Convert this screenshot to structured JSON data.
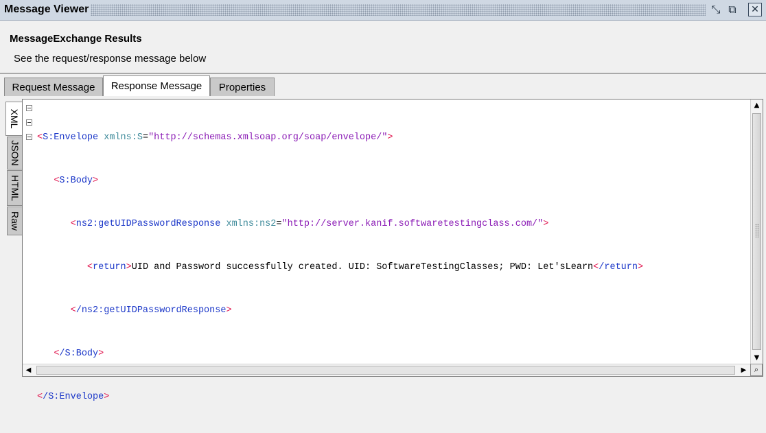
{
  "window": {
    "title": "Message Viewer",
    "icons": [
      "minimize-restore-icon",
      "maximize-icon",
      "close-icon"
    ]
  },
  "header": {
    "title": "MessageExchange Results",
    "subtitle": "See the request/response message below"
  },
  "tabs": [
    {
      "label": "Request Message",
      "active": false
    },
    {
      "label": "Response Message",
      "active": true
    },
    {
      "label": "Properties",
      "active": false
    }
  ],
  "view_tabs": [
    {
      "label": "XML",
      "active": true
    },
    {
      "label": "JSON",
      "active": false
    },
    {
      "label": "HTML",
      "active": false
    },
    {
      "label": "Raw",
      "active": false
    }
  ],
  "xml": {
    "l1_tag": "S:Envelope",
    "l1_attr": "xmlns:S",
    "l1_val": "\"http://schemas.xmlsoap.org/soap/envelope/\"",
    "l2_tag": "S:Body",
    "l3_tag": "ns2:getUIDPasswordResponse",
    "l3_attr": "xmlns:ns2",
    "l3_val": "\"http://server.kanif.softwaretestingclass.com/\"",
    "l4_tag": "return",
    "l4_text": "UID and Password successfully created. UID: SoftwareTestingClasses; PWD: Let'sLearn",
    "l4_close": "/return",
    "l5_close": "/ns2:getUIDPasswordResponse",
    "l6_close": "/S:Body",
    "l7_close": "/S:Envelope"
  },
  "colors": {
    "bracket": "#e0104a",
    "tag": "#1a36c8",
    "attribute": "#3e8a9a",
    "value": "#8a1ab5",
    "titlebar": "#cfd8e3"
  }
}
